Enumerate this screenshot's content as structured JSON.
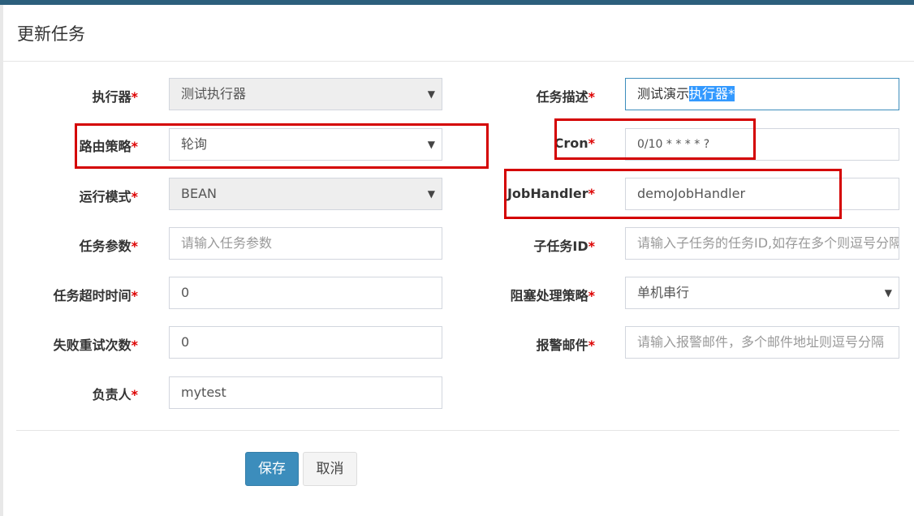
{
  "dialog": {
    "title": "更新任务"
  },
  "required_mark": "*",
  "form": {
    "executor": {
      "label": "执行器",
      "value": "测试执行器"
    },
    "route": {
      "label": "路由策略",
      "value": "轮询"
    },
    "run_mode": {
      "label": "运行模式",
      "value": "BEAN"
    },
    "params": {
      "label": "任务参数",
      "placeholder": "请输入任务参数"
    },
    "timeout": {
      "label": "任务超时时间",
      "value": "0"
    },
    "retry": {
      "label": "失败重试次数",
      "value": "0"
    },
    "owner": {
      "label": "负责人",
      "value": "mytest"
    },
    "desc": {
      "label": "任务描述",
      "value_plain": "测试演示",
      "value_selected": "执行器*"
    },
    "cron": {
      "label": "Cron",
      "value": "0/10 * * * * ?"
    },
    "handler": {
      "label": "JobHandler",
      "value": "demoJobHandler"
    },
    "child_id": {
      "label": "子任务ID",
      "placeholder": "请输入子任务的任务ID,如存在多个则逗号分隔"
    },
    "block": {
      "label": "阻塞处理策略",
      "value": "单机串行"
    },
    "alarm": {
      "label": "报警邮件",
      "placeholder": "请输入报警邮件，多个邮件地址则逗号分隔"
    }
  },
  "buttons": {
    "save": "保存",
    "cancel": "取消"
  },
  "caret_glyph": "▼",
  "colors": {
    "primary": "#3c8dbc",
    "highlight_box": "#d40000",
    "required": "#dd0000"
  }
}
